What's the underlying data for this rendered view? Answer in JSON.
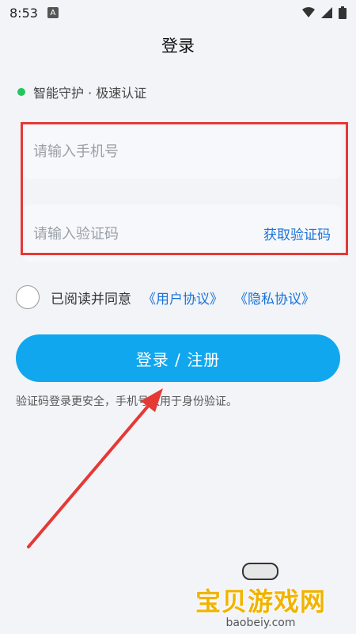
{
  "status_bar": {
    "time": "8:53",
    "notif_letter": "A"
  },
  "nav": {
    "title": "登录"
  },
  "security": {
    "text": "智能守护 · 极速认证"
  },
  "form": {
    "phone_placeholder": "请输入手机号",
    "code_placeholder": "请输入验证码",
    "get_code_label": "获取验证码"
  },
  "agreement": {
    "text": "已阅读并同意",
    "user_link": "《用户协议》",
    "privacy_link": "《隐私协议》"
  },
  "login_button": {
    "label": "登录 / 注册"
  },
  "hint": {
    "text": "验证码登录更安全，手机号仅用于身份验证。"
  },
  "watermark": {
    "cn": "宝贝游戏网",
    "en": "baobeiy.com"
  },
  "colors": {
    "accent": "#10a7ef",
    "link": "#1a73d9",
    "highlight": "#e53935",
    "status_dot": "#22c55e"
  }
}
